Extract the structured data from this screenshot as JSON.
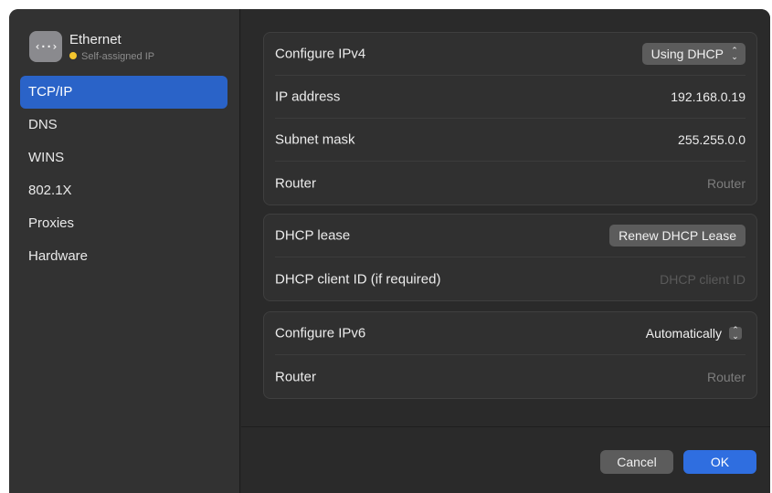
{
  "sidebar": {
    "network": {
      "icon_glyph": "‹··›",
      "icon_name": "ethernet-icon",
      "title": "Ethernet",
      "status": "Self-assigned IP",
      "status_color": "#f3c52e"
    },
    "items": [
      {
        "label": "TCP/IP",
        "selected": true
      },
      {
        "label": "DNS",
        "selected": false
      },
      {
        "label": "WINS",
        "selected": false
      },
      {
        "label": "802.1X",
        "selected": false
      },
      {
        "label": "Proxies",
        "selected": false
      },
      {
        "label": "Hardware",
        "selected": false
      }
    ]
  },
  "ipv4": {
    "configure_label": "Configure IPv4",
    "configure_value": "Using DHCP",
    "ip_label": "IP address",
    "ip_value": "192.168.0.19",
    "subnet_label": "Subnet mask",
    "subnet_value": "255.255.0.0",
    "router_label": "Router",
    "router_placeholder": "Router"
  },
  "dhcp": {
    "lease_label": "DHCP lease",
    "renew_button": "Renew DHCP Lease",
    "client_id_label": "DHCP client ID (if required)",
    "client_id_placeholder": "DHCP client ID"
  },
  "ipv6": {
    "configure_label": "Configure IPv6",
    "configure_value": "Automatically",
    "router_label": "Router",
    "router_placeholder": "Router"
  },
  "footer": {
    "cancel_label": "Cancel",
    "ok_label": "OK"
  },
  "colors": {
    "accent": "#2a63c8",
    "ok_button": "#2f6ee0"
  }
}
